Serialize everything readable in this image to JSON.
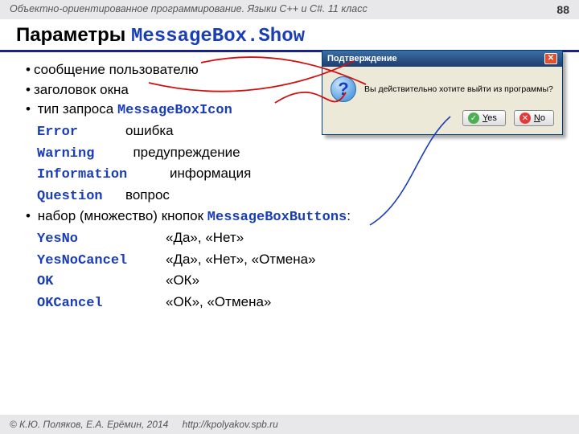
{
  "header": {
    "course": "Объектно-ориентированное программирование. Языки C++ и C#. 11 класс",
    "page": "88"
  },
  "title": {
    "text": "Параметры ",
    "code": "MessageBox.Show"
  },
  "bullets": {
    "b1": "сообщение пользователю",
    "b2": "заголовок окна",
    "b3_prefix": "тип запроса ",
    "b3_code": "MessageBoxIcon",
    "icons": [
      {
        "code": "Error",
        "label": "ошибка"
      },
      {
        "code": "Warning",
        "label": "предупреждение"
      },
      {
        "code": "Information",
        "label": "информация"
      },
      {
        "code": "Question",
        "label": "вопрос"
      }
    ],
    "b4_prefix": "набор (множество) кнопок ",
    "b4_code": "MessageBoxButtons",
    "b4_suffix": ":",
    "buttons": [
      {
        "code": "YesNo",
        "label": "«Да», «Нет»"
      },
      {
        "code": "YesNoCancel",
        "label": "«Да», «Нет», «Отмена»"
      },
      {
        "code": "OK",
        "label": "«ОК»"
      },
      {
        "code": "OKCancel",
        "label": "«ОК», «Отмена»"
      }
    ]
  },
  "dialog": {
    "title": "Подтверждение",
    "msg": "Вы действительно хотите выйти из программы?",
    "yes_u": "Y",
    "yes_rest": "es",
    "no_u": "N",
    "no_rest": "o"
  },
  "footer": {
    "copy": "© К.Ю. Поляков, Е.А. Ерёмин, 2014",
    "url": "http://kpolyakov.spb.ru"
  }
}
